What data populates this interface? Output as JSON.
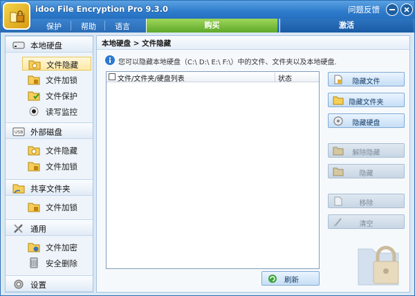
{
  "titlebar": {
    "app_title": "idoo File Encryption Pro 9.3.0",
    "feedback": "问题反馈",
    "minimize_icon": "minimize-icon",
    "close_icon": "close-icon"
  },
  "menu": {
    "protect": "保护",
    "help": "帮助",
    "language": "语言",
    "buy": "购买",
    "activate": "激活"
  },
  "sidebar": {
    "local_disk": {
      "label": "本地硬盘",
      "items": [
        {
          "label": "文件隐藏",
          "icon": "hide-folder-icon",
          "active": true
        },
        {
          "label": "文件加锁",
          "icon": "lock-folder-icon"
        },
        {
          "label": "文件保护",
          "icon": "protect-folder-icon"
        },
        {
          "label": "读写监控",
          "icon": "monitor-icon"
        }
      ]
    },
    "external_disk": {
      "label": "外部磁盘",
      "items": [
        {
          "label": "文件隐藏",
          "icon": "hide-folder-icon"
        },
        {
          "label": "文件加锁",
          "icon": "lock-folder-icon"
        }
      ]
    },
    "shared_folder": {
      "label": "共享文件夹",
      "items": [
        {
          "label": "文件加锁",
          "icon": "lock-folder-icon"
        }
      ]
    },
    "general": {
      "label": "通用",
      "items": [
        {
          "label": "文件加密",
          "icon": "encrypt-folder-icon"
        },
        {
          "label": "安全删除",
          "icon": "shred-icon"
        }
      ]
    },
    "settings": {
      "label": "设置"
    }
  },
  "main": {
    "breadcrumb": "本地硬盘 > 文件隐藏",
    "info_text": "您可以隐藏本地硬盘（C:\\ D:\\ E:\\ F:\\）中的文件、文件夹以及本地硬盘.",
    "list_columns": [
      "文件/文件夹/硬盘列表",
      "状态"
    ],
    "actions": {
      "hide_file": "隐藏文件",
      "hide_folder": "隐藏文件夹",
      "hide_disk": "隐藏硬盘",
      "unhide": "解除隐藏",
      "hide": "隐藏",
      "remove": "移除",
      "clear": "清空"
    },
    "refresh": "刷新"
  }
}
